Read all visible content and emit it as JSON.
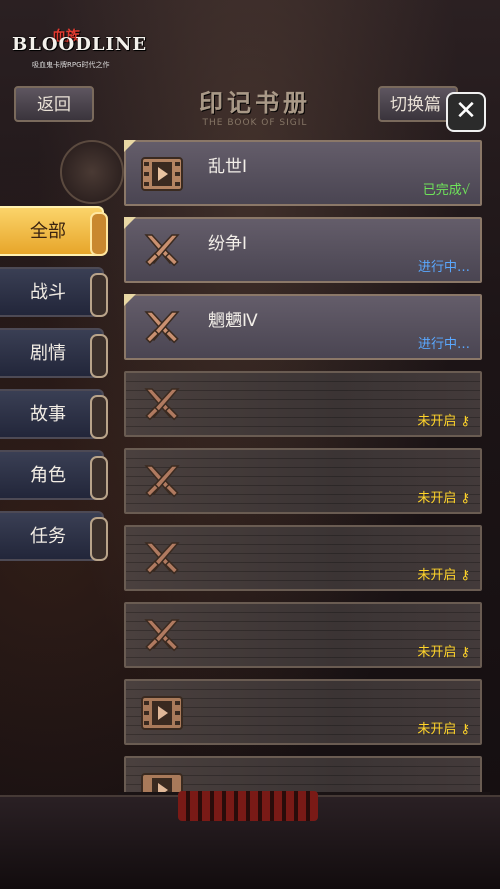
{
  "logo": {
    "main": "BLOODLINE",
    "red": "血族",
    "sub": "吸血鬼卡牌RPG时代之作"
  },
  "header": {
    "back_label": "返回",
    "switch_label": "切换篇",
    "close_label": "✕",
    "title": "印记书册",
    "subtitle": "THE BOOK OF SIGIL"
  },
  "tabs": [
    {
      "label": "全部",
      "active": true
    },
    {
      "label": "战斗",
      "active": false
    },
    {
      "label": "剧情",
      "active": false
    },
    {
      "label": "故事",
      "active": false
    },
    {
      "label": "角色",
      "active": false
    },
    {
      "label": "任务",
      "active": false
    }
  ],
  "entries": [
    {
      "name": "乱世Ⅰ",
      "status": "已完成√",
      "state": "done",
      "icon": "film-icon"
    },
    {
      "name": "纷争Ⅰ",
      "status": "进行中…",
      "state": "progress",
      "icon": "crossed-swords-icon"
    },
    {
      "name": "魍魉Ⅳ",
      "status": "进行中…",
      "state": "progress",
      "icon": "crossed-swords-icon"
    },
    {
      "name": "",
      "status": "未开启",
      "state": "locked",
      "icon": "crossed-swords-icon"
    },
    {
      "name": "",
      "status": "未开启",
      "state": "locked",
      "icon": "crossed-swords-icon"
    },
    {
      "name": "",
      "status": "未开启",
      "state": "locked",
      "icon": "crossed-swords-icon"
    },
    {
      "name": "",
      "status": "未开启",
      "state": "locked",
      "icon": "crossed-swords-icon"
    },
    {
      "name": "",
      "status": "未开启",
      "state": "locked",
      "icon": "film-icon"
    },
    {
      "name": "",
      "status": "",
      "state": "locked",
      "icon": "film-icon"
    }
  ]
}
